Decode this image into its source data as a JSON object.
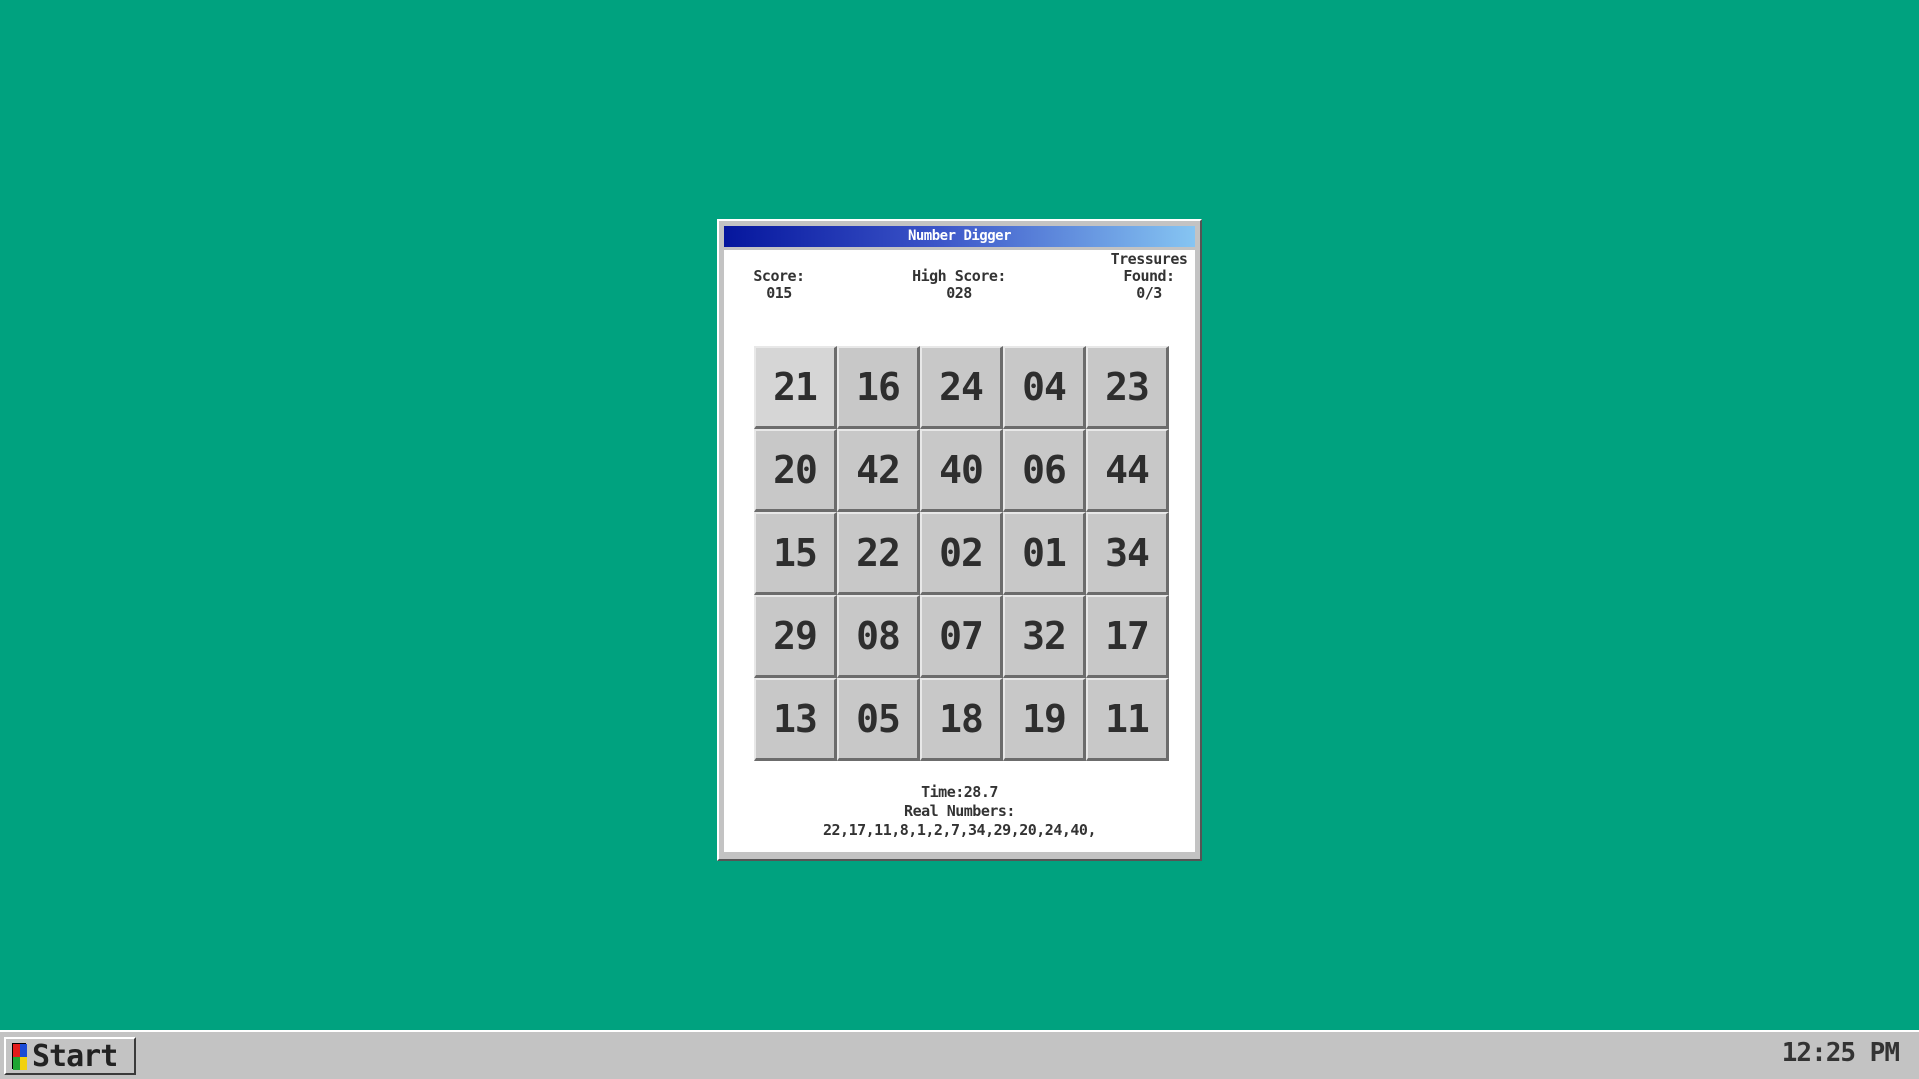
{
  "window": {
    "title": "Number Digger"
  },
  "stats": {
    "score_label": "Score:",
    "score_value": "015",
    "high_score_label": "High Score:",
    "high_score_value": "028",
    "treasures_label_1": "Tressures",
    "treasures_label_2": "Found:",
    "treasures_value": "0/3"
  },
  "grid": {
    "cells": [
      "21",
      "16",
      "24",
      "04",
      "23",
      "20",
      "42",
      "40",
      "06",
      "44",
      "15",
      "22",
      "02",
      "01",
      "34",
      "29",
      "08",
      "07",
      "32",
      "17",
      "13",
      "05",
      "18",
      "19",
      "11"
    ],
    "hovered_index": 0
  },
  "footer": {
    "time": "Time:28.7",
    "real_numbers_label": "Real Numbers:",
    "real_numbers_value": "22,17,11,8,1,2,7,34,29,20,24,40,"
  },
  "taskbar": {
    "start_label": "Start",
    "start_icon": "windows-logo-icon",
    "clock": "12:25 PM"
  },
  "colors": {
    "desktop": "#00a27f",
    "titlebar_start": "#05169d",
    "titlebar_end": "#86c5f2",
    "logo_colors": [
      "#e31b1b",
      "#1a4bd6",
      "#1fa533",
      "#f2d10d"
    ]
  }
}
